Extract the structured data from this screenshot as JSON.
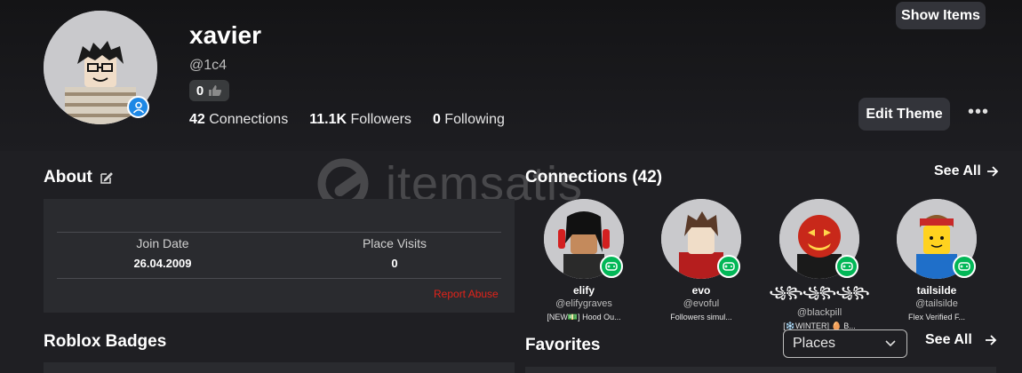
{
  "header": {
    "show_items_label": "Show Items",
    "display_name": "xavier",
    "username": "@1c4",
    "likes": "0",
    "stats": {
      "connections_count": "42",
      "connections_label": "Connections",
      "followers_count": "11.1K",
      "followers_label": "Followers",
      "following_count": "0",
      "following_label": "Following"
    },
    "edit_theme_label": "Edit Theme",
    "more_label": "•••"
  },
  "watermark": {
    "text": "itemsatis"
  },
  "about": {
    "title": "About",
    "join_date_label": "Join Date",
    "join_date_value": "26.04.2009",
    "place_visits_label": "Place Visits",
    "place_visits_value": "0",
    "report_abuse_label": "Report Abuse"
  },
  "badges": {
    "title": "Roblox Badges"
  },
  "connections": {
    "title": "Connections (42)",
    "see_all_label": "See All",
    "friends": [
      {
        "name": "elify",
        "username": "@elifygraves",
        "status": "[NEW💵] Hood Ou..."
      },
      {
        "name": "evo",
        "username": "@evoful",
        "status": "Followers simul..."
      },
      {
        "name": "꧁꧂꧁꧂꧁꧂",
        "username": "@blackpill",
        "status": "[❄️WINTER] 🥚 B..."
      },
      {
        "name": "tailsilde",
        "username": "@tailsilde",
        "status": "Flex Verified F..."
      }
    ]
  },
  "favorites": {
    "title": "Favorites",
    "select_value": "Places",
    "see_all_label": "See All"
  },
  "colors": {
    "background": "#1f1f23",
    "panel": "#2a2b2f",
    "button": "#33343a",
    "presence_blue": "#1e88e5",
    "game_green": "#02b757",
    "report_red": "#e2231a"
  }
}
